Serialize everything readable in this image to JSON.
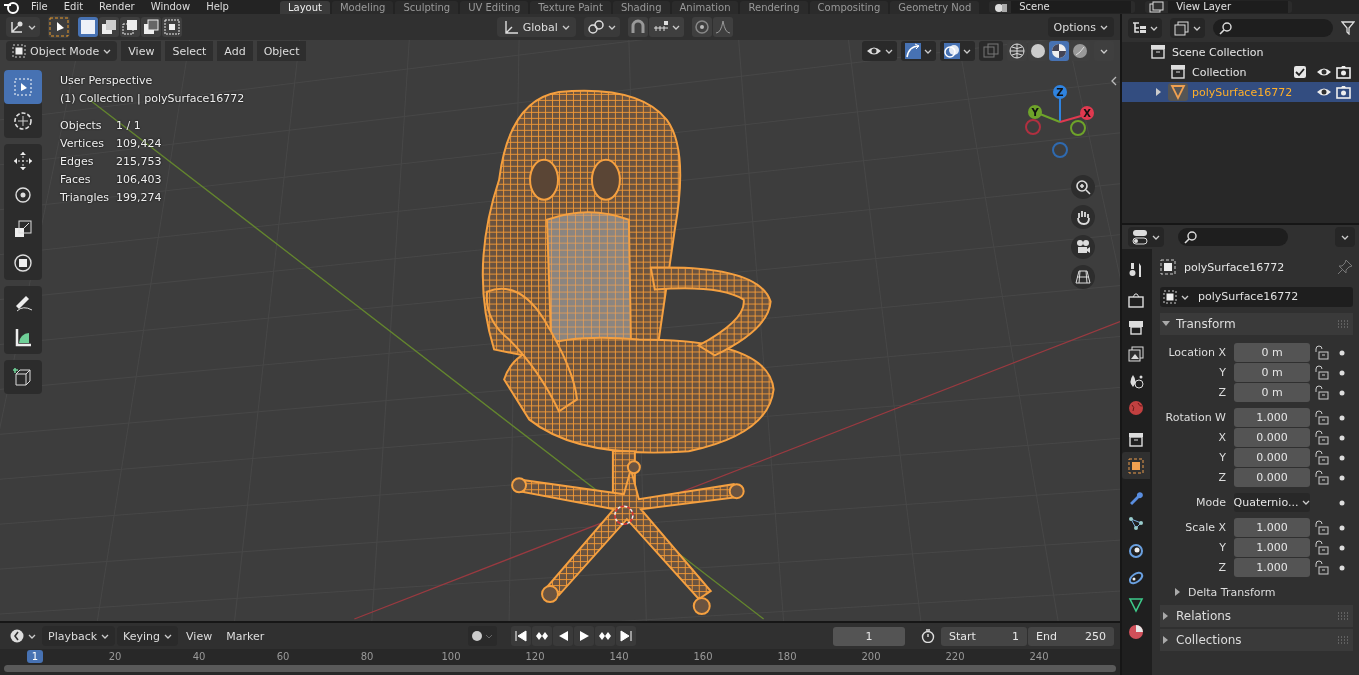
{
  "menu": [
    "File",
    "Edit",
    "Render",
    "Window",
    "Help"
  ],
  "workspaces": [
    {
      "label": "Layout",
      "selected": true
    },
    {
      "label": "Modeling",
      "selected": false
    },
    {
      "label": "Sculpting",
      "selected": false
    },
    {
      "label": "UV Editing",
      "selected": false
    },
    {
      "label": "Texture Paint",
      "selected": false
    },
    {
      "label": "Shading",
      "selected": false
    },
    {
      "label": "Animation",
      "selected": false
    },
    {
      "label": "Rendering",
      "selected": false
    },
    {
      "label": "Compositing",
      "selected": false
    },
    {
      "label": "Geometry Nod",
      "selected": false
    }
  ],
  "scene": "Scene",
  "view_layer": "View Layer",
  "tool_header": {
    "select_modes": [
      {
        "kind": "set",
        "selected": true
      },
      {
        "kind": "extend",
        "selected": false
      },
      {
        "kind": "subtract",
        "selected": false
      },
      {
        "kind": "invert",
        "selected": false
      },
      {
        "kind": "intersect",
        "selected": false
      }
    ],
    "orientation": "Global",
    "options": "Options"
  },
  "viewport": {
    "mode": "Object Mode",
    "menus": [
      "View",
      "Select",
      "Add",
      "Object"
    ],
    "toggles": [
      {
        "kind": "selectability",
        "on": false
      },
      {
        "kind": "gizmos",
        "on": true
      },
      {
        "kind": "overlays",
        "on": true
      },
      {
        "kind": "xray",
        "on": false
      }
    ],
    "shading": [
      {
        "kind": "wireframe",
        "selected": false
      },
      {
        "kind": "solid",
        "selected": false
      },
      {
        "kind": "material",
        "selected": true
      },
      {
        "kind": "rendered",
        "selected": false
      }
    ],
    "title": "User Perspective",
    "subtitle": "(1) Collection | polySurface16772",
    "stats": [
      {
        "label": "Objects",
        "value": "1 / 1"
      },
      {
        "label": "Vertices",
        "value": "109,424"
      },
      {
        "label": "Edges",
        "value": "215,753"
      },
      {
        "label": "Faces",
        "value": "106,403"
      },
      {
        "label": "Triangles",
        "value": "199,274"
      }
    ],
    "tools": [
      {
        "kind": "select",
        "selected": true
      },
      {
        "kind": "cursor",
        "selected": false
      },
      {
        "kind": "move",
        "selected": false
      },
      {
        "kind": "rotate",
        "selected": false
      },
      {
        "kind": "scale",
        "selected": false
      },
      {
        "kind": "transform",
        "selected": false
      },
      {
        "kind": "annotate",
        "selected": false
      },
      {
        "kind": "measure",
        "selected": false
      },
      {
        "kind": "add_cube",
        "selected": false
      }
    ],
    "axes": [
      {
        "label": "Z",
        "color": "#2f83e0"
      },
      {
        "label": "Y",
        "color": "#6ea32a"
      },
      {
        "label": "X",
        "color": "#e0394f"
      }
    ]
  },
  "outliner": {
    "items": [
      {
        "label": "Scene Collection",
        "kind": "scene",
        "selected": false,
        "children": [
          {
            "label": "Collection",
            "kind": "collection",
            "selected": false,
            "checked": true
          },
          {
            "label": "polySurface16772",
            "kind": "mesh",
            "selected": true,
            "expanded": false
          }
        ]
      }
    ]
  },
  "properties": {
    "tabs": [
      {
        "kind": "tool",
        "selected": false
      },
      {
        "kind": "render",
        "selected": false
      },
      {
        "kind": "output",
        "selected": false
      },
      {
        "kind": "view_layer",
        "selected": false
      },
      {
        "kind": "scene",
        "selected": false
      },
      {
        "kind": "world",
        "selected": false
      },
      {
        "kind": "collection",
        "selected": false
      },
      {
        "kind": "object",
        "selected": true
      },
      {
        "kind": "modifiers",
        "selected": false
      },
      {
        "kind": "particles",
        "selected": false
      },
      {
        "kind": "physics",
        "selected": false
      },
      {
        "kind": "constraints",
        "selected": false
      },
      {
        "kind": "data",
        "selected": false
      },
      {
        "kind": "material",
        "selected": false
      }
    ],
    "object_name": "polySurface16772",
    "name_field": "polySurface16772",
    "transform": {
      "title": "Transform",
      "expanded": true,
      "groups": [
        [
          {
            "label": "Location X",
            "value": "0 m"
          },
          {
            "label": "Y",
            "value": "0 m"
          },
          {
            "label": "Z",
            "value": "0 m"
          }
        ],
        [
          {
            "label": "Rotation W",
            "value": "1.000"
          },
          {
            "label": "X",
            "value": "0.000"
          },
          {
            "label": "Y",
            "value": "0.000"
          },
          {
            "label": "Z",
            "value": "0.000"
          }
        ],
        [
          {
            "label": "Mode",
            "value": "Quaternio...",
            "kind": "dropdown"
          }
        ],
        [
          {
            "label": "Scale X",
            "value": "1.000"
          },
          {
            "label": "Y",
            "value": "1.000"
          },
          {
            "label": "Z",
            "value": "1.000"
          }
        ]
      ],
      "subpanels": [
        {
          "title": "Delta Transform",
          "expanded": false
        }
      ]
    },
    "panels": [
      {
        "title": "Relations",
        "expanded": false
      },
      {
        "title": "Collections",
        "expanded": false
      }
    ]
  },
  "timeline": {
    "menus": [
      "Playback",
      "Keying",
      "View",
      "Marker"
    ],
    "current_frame": "1",
    "start_label": "Start",
    "start": "1",
    "end_label": "End",
    "end": "250",
    "playhead": "1",
    "ticks": [
      "20",
      "40",
      "60",
      "80",
      "100",
      "120",
      "140",
      "160",
      "180",
      "200",
      "220",
      "240"
    ]
  }
}
